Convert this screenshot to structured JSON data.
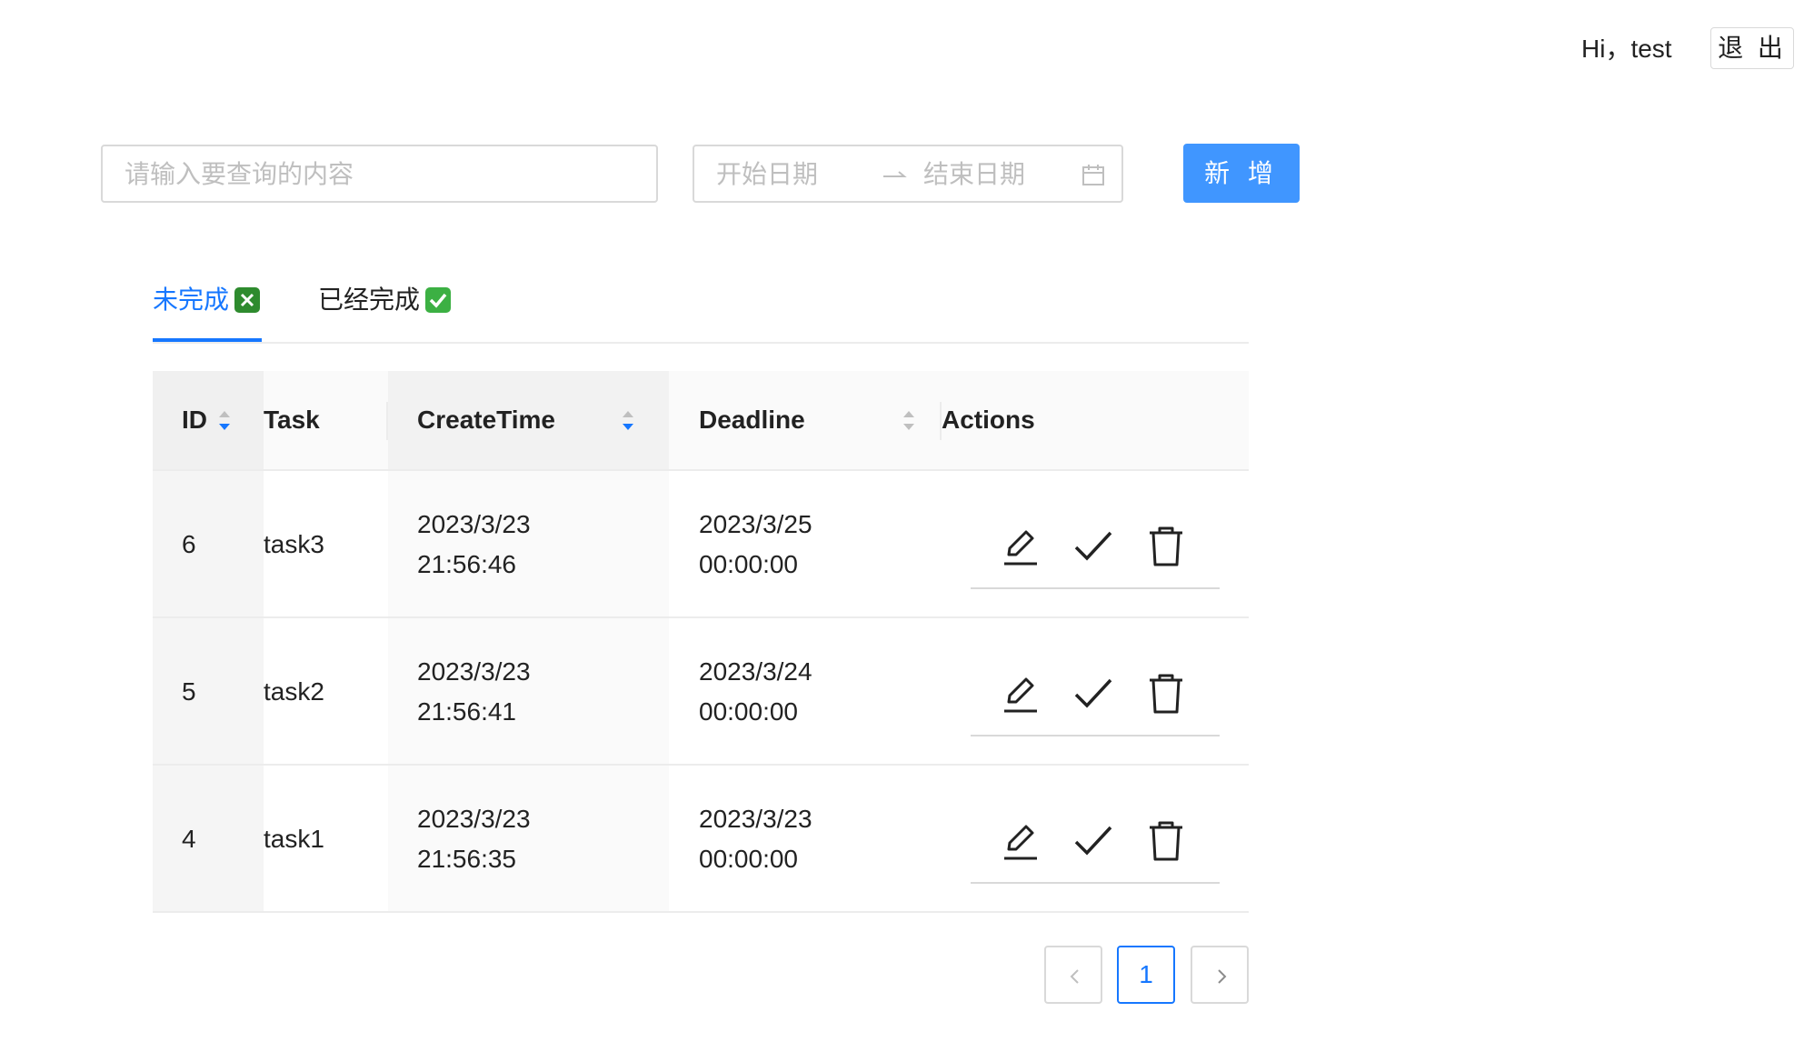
{
  "header": {
    "greeting": "Hi，test",
    "logout_label": "退 出"
  },
  "search": {
    "placeholder": "请输入要查询的内容"
  },
  "date_range": {
    "start_placeholder": "开始日期",
    "end_placeholder": "结束日期"
  },
  "toolbar": {
    "add_label": "新 增"
  },
  "tabs": [
    {
      "label": "未完成",
      "icon": "cross-mark-emoji-icon",
      "active": true
    },
    {
      "label": "已经完成",
      "icon": "check-mark-emoji-icon",
      "active": false
    }
  ],
  "table": {
    "columns": [
      "ID",
      "Task",
      "CreateTime",
      "Deadline",
      "Actions"
    ],
    "rows": [
      {
        "id": "6",
        "task": "task3",
        "create_date": "2023/3/23",
        "create_time": "21:56:46",
        "deadline_date": "2023/3/25",
        "deadline_time": "00:00:00"
      },
      {
        "id": "5",
        "task": "task2",
        "create_date": "2023/3/23",
        "create_time": "21:56:41",
        "deadline_date": "2023/3/24",
        "deadline_time": "00:00:00"
      },
      {
        "id": "4",
        "task": "task1",
        "create_date": "2023/3/23",
        "create_time": "21:56:35",
        "deadline_date": "2023/3/23",
        "deadline_time": "00:00:00"
      }
    ],
    "row_actions": [
      "edit-icon",
      "check-icon",
      "delete-icon"
    ]
  },
  "pagination": {
    "current_page": "1"
  },
  "colors": {
    "primary": "#1677ff",
    "button": "#4096ff",
    "border": "#d9d9d9",
    "text": "#222222",
    "placeholder": "#bfbfbf"
  }
}
